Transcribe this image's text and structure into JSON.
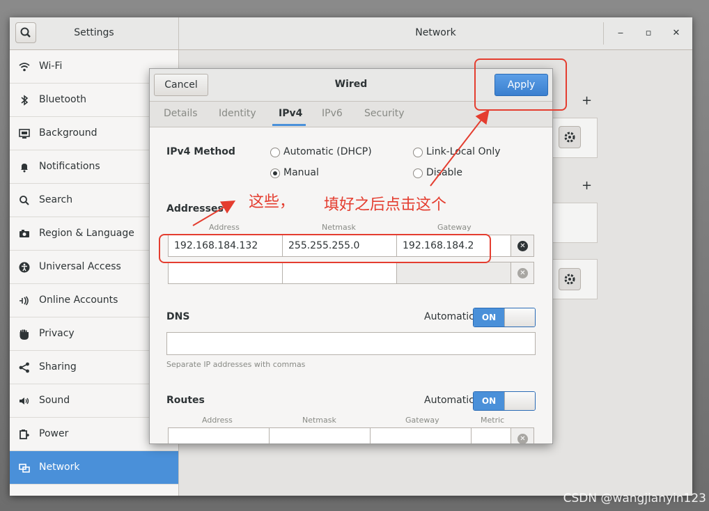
{
  "settings": {
    "title": "Settings",
    "panel_title": "Network",
    "window_controls": {
      "minimize": "‒",
      "maximize": "▫",
      "close": "✕"
    }
  },
  "sidebar": {
    "items": [
      {
        "label": "Wi-Fi",
        "icon": "wifi-icon"
      },
      {
        "label": "Bluetooth",
        "icon": "bluetooth-icon"
      },
      {
        "label": "Background",
        "icon": "background-icon"
      },
      {
        "label": "Notifications",
        "icon": "bell-icon"
      },
      {
        "label": "Search",
        "icon": "search-icon"
      },
      {
        "label": "Region & Language",
        "icon": "camera-icon"
      },
      {
        "label": "Universal Access",
        "icon": "accessibility-icon"
      },
      {
        "label": "Online Accounts",
        "icon": "online-accounts-icon"
      },
      {
        "label": "Privacy",
        "icon": "hand-icon"
      },
      {
        "label": "Sharing",
        "icon": "share-icon"
      },
      {
        "label": "Sound",
        "icon": "speaker-icon"
      },
      {
        "label": "Power",
        "icon": "power-icon"
      },
      {
        "label": "Network",
        "icon": "network-icon",
        "active": true
      }
    ]
  },
  "background_panel": {
    "plus": "+"
  },
  "dialog": {
    "title": "Wired",
    "cancel_label": "Cancel",
    "apply_label": "Apply",
    "tabs": [
      {
        "label": "Details"
      },
      {
        "label": "Identity"
      },
      {
        "label": "IPv4",
        "active": true
      },
      {
        "label": "IPv6"
      },
      {
        "label": "Security"
      }
    ],
    "ipv4_method_label": "IPv4 Method",
    "methods": {
      "automatic_dhcp": "Automatic (DHCP)",
      "link_local": "Link-Local Only",
      "manual": "Manual",
      "disable": "Disable",
      "selected": "Manual"
    },
    "addresses": {
      "heading": "Addresses",
      "columns": [
        "Address",
        "Netmask",
        "Gateway"
      ],
      "rows": [
        {
          "address": "192.168.184.132",
          "netmask": "255.255.255.0",
          "gateway": "192.168.184.2"
        },
        {
          "address": "",
          "netmask": "",
          "gateway": ""
        }
      ]
    },
    "dns": {
      "heading": "DNS",
      "automatic_label": "Automatic",
      "toggle": "ON",
      "value": "",
      "hint": "Separate IP addresses with commas"
    },
    "routes": {
      "heading": "Routes",
      "automatic_label": "Automatic",
      "toggle": "ON",
      "columns": [
        "Address",
        "Netmask",
        "Gateway",
        "Metric"
      ]
    }
  },
  "annotations": {
    "these": "这些，",
    "click_this": "填好之后点击这个",
    "color": "#e43d2f"
  },
  "watermark": "CSDN @wangjianyin123",
  "colors": {
    "accent": "#4a90d9",
    "annotation": "#e43d2f"
  }
}
